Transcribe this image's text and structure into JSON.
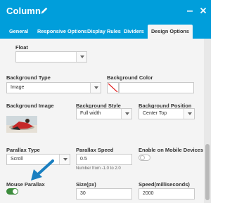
{
  "header": {
    "title": "Column",
    "background_color": "#009edb"
  },
  "tabs": [
    {
      "label": "General",
      "active": false
    },
    {
      "label": "Responsive Options",
      "active": false
    },
    {
      "label": "Display Rules",
      "active": false
    },
    {
      "label": "Dividers",
      "active": false
    },
    {
      "label": "Design Options",
      "active": true
    }
  ],
  "form": {
    "float": {
      "label": "Float",
      "value": ""
    },
    "background_type": {
      "label": "Background Type",
      "value": "Image"
    },
    "background_color": {
      "label": "Background Color",
      "value": ""
    },
    "background_image": {
      "label": "Background Image"
    },
    "background_style": {
      "label": "Background Style",
      "value": "Full width"
    },
    "background_position": {
      "label": "Background Position",
      "value": "Center Top"
    },
    "parallax_type": {
      "label": "Parallax Type",
      "value": "Scroll"
    },
    "parallax_speed": {
      "label": "Parallax Speed",
      "value": "0.5",
      "hint": "Number from -1.0 to 2.0"
    },
    "enable_on_mobile": {
      "label": "Enable on Mobile Devices",
      "enabled": false
    },
    "mouse_parallax": {
      "label": "Mouse Parallax",
      "enabled": true
    },
    "size": {
      "label": "Size(px)",
      "value": "30"
    },
    "speed": {
      "label": "Speed(milliseconds)",
      "value": "2000"
    }
  },
  "colors": {
    "accent": "#009edb",
    "toggle_on": "#3c8c3c",
    "arrow": "#1a7fc0"
  }
}
